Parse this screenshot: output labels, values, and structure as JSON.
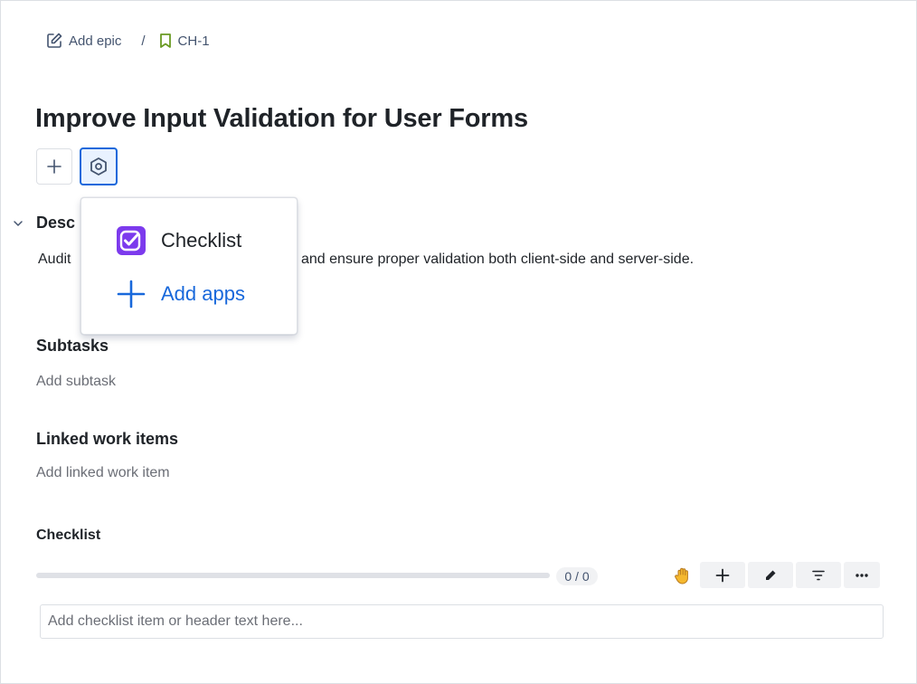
{
  "breadcrumb": {
    "epic_label": "Add epic",
    "separator": "/",
    "issue_key": "CH-1"
  },
  "issue": {
    "title": "Improve Input Validation for User Forms"
  },
  "description": {
    "heading_visible": "Desc",
    "text_start": "Audit",
    "text_end": "and ensure proper validation both client-side and server-side."
  },
  "apps_menu": {
    "items": [
      {
        "label": "Checklist",
        "icon": "checklist-app-icon"
      },
      {
        "label": "Add apps",
        "icon": "plus-icon"
      }
    ]
  },
  "subtasks": {
    "heading": "Subtasks",
    "placeholder": "Add subtask"
  },
  "linked": {
    "heading": "Linked work items",
    "placeholder": "Add linked work item"
  },
  "checklist": {
    "heading": "Checklist",
    "progress": 0,
    "count_label": "0 / 0",
    "toolbar_icons": [
      "hand-icon",
      "plus-icon",
      "pencil-icon",
      "filter-icon",
      "more-icon"
    ],
    "input_placeholder": "Add checklist item or header text here..."
  },
  "colors": {
    "accent": "#1868db",
    "checklist_brand": "#7c3aed",
    "issue_icon": "#6a9a23"
  }
}
